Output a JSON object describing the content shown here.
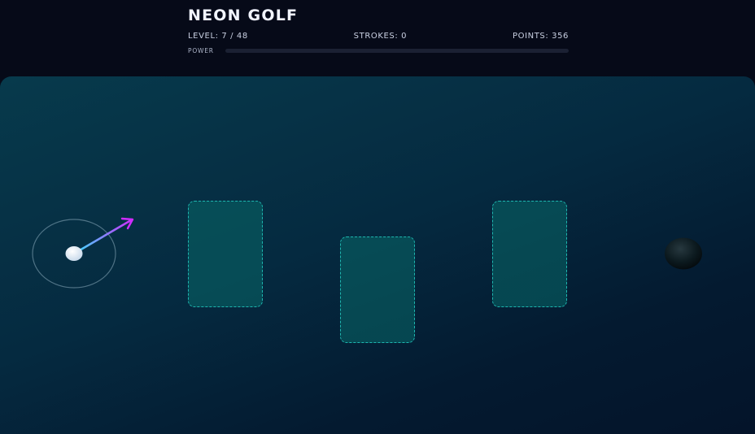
{
  "game": {
    "title": "NEON GOLF",
    "level_text": "LEVEL: 7 / 48",
    "strokes_text": "STROKES: 0",
    "points_text": "POINTS: 356",
    "power_label": "POWER",
    "power_fraction": 0
  },
  "course": {
    "obstacle_count": 3
  },
  "colors": {
    "background": "#060a18",
    "course": "#052a40",
    "obstacle_fill": "#086868",
    "obstacle_border": "#1eb6b0",
    "aim_start": "#39e0ff",
    "aim_end": "#d02cff",
    "ball": "#eef4ff",
    "hole": "#0a1418"
  }
}
